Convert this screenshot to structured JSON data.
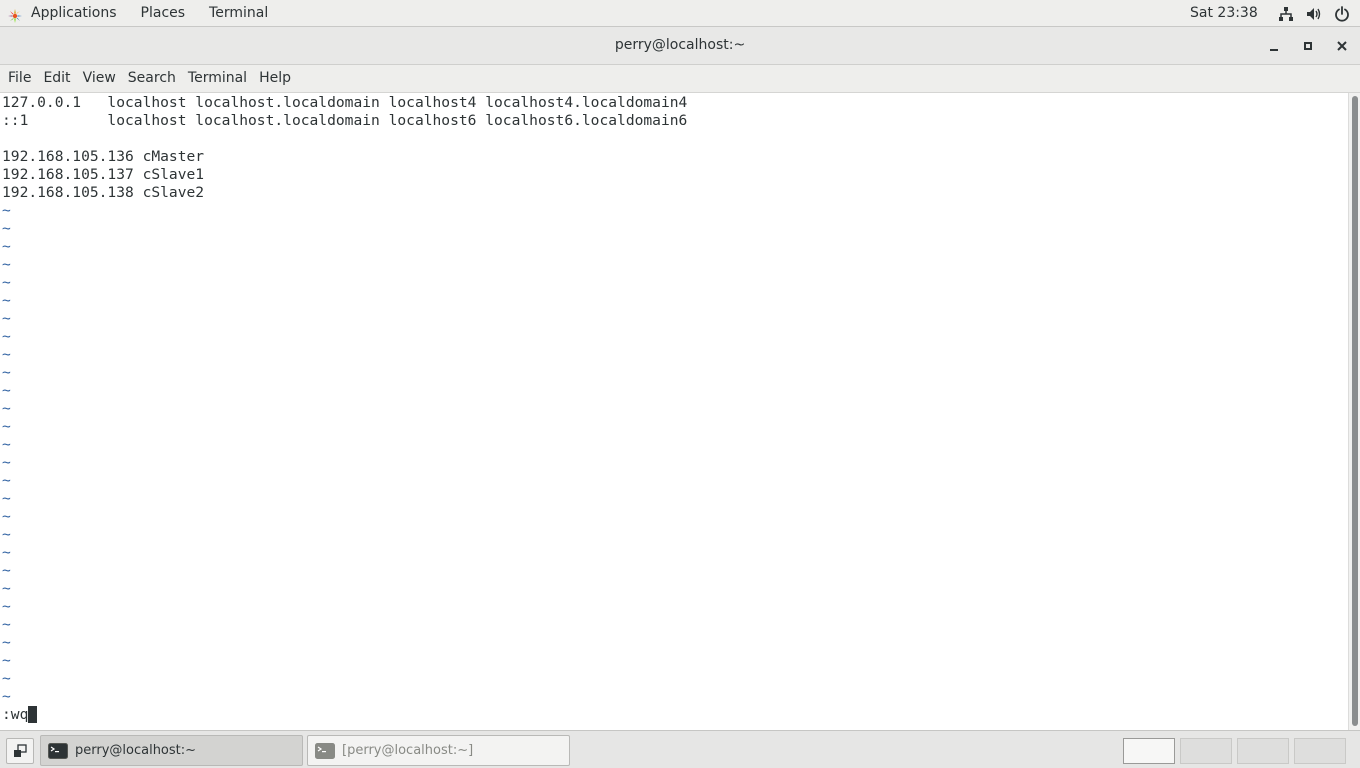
{
  "top_bar": {
    "applications_label": "Applications",
    "places_label": "Places",
    "terminal_label": "Terminal",
    "clock": "Sat 23:38",
    "icons": [
      "network-icon",
      "volume-icon",
      "power-icon"
    ]
  },
  "window": {
    "title": "perry@localhost:~"
  },
  "menu": {
    "file": "File",
    "edit": "Edit",
    "view": "View",
    "search": "Search",
    "terminal": "Terminal",
    "help": "Help"
  },
  "terminal": {
    "lines": [
      "127.0.0.1   localhost localhost.localdomain localhost4 localhost4.localdomain4",
      "::1         localhost localhost.localdomain localhost6 localhost6.localdomain6",
      "",
      "192.168.105.136 cMaster",
      "192.168.105.137 cSlave1",
      "192.168.105.138 cSlave2"
    ],
    "tilde_char": "~",
    "tilde_count": 28,
    "command": ":wq"
  },
  "taskbar": {
    "tasks": [
      {
        "label": "perry@localhost:~",
        "active": true
      },
      {
        "label": "[perry@localhost:~]",
        "active": false
      }
    ],
    "workspaces": 4,
    "active_workspace": 1
  },
  "colors": {
    "tilde": "#3465a4",
    "text": "#2e3436",
    "panel": "#eeeeec"
  }
}
